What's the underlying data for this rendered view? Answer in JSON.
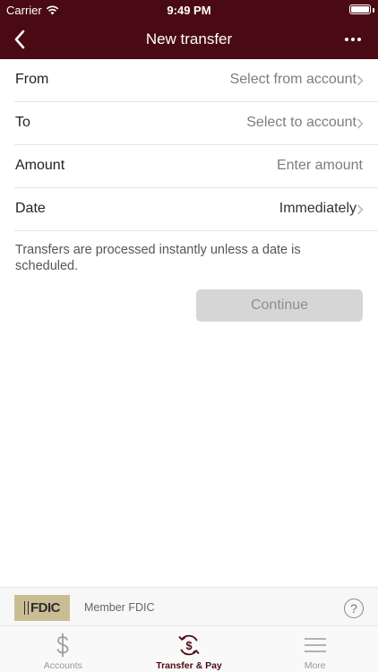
{
  "status_bar": {
    "carrier": "Carrier",
    "time": "9:49 PM"
  },
  "nav": {
    "title": "New transfer",
    "back_icon": "chevron-left-icon",
    "more_icon": "ellipsis-icon"
  },
  "form": {
    "rows": [
      {
        "label": "From",
        "value": "Select from account"
      },
      {
        "label": "To",
        "value": "Select to account"
      },
      {
        "label": "Amount",
        "placeholder": "Enter amount",
        "value": ""
      },
      {
        "label": "Date",
        "value": "Immediately"
      }
    ],
    "note": "Transfers are processed instantly unless a date is scheduled.",
    "continue_label": "Continue"
  },
  "footer": {
    "fdic_logo": "FDIC",
    "fdic_text": "Member FDIC",
    "help_icon": "question-circle-icon"
  },
  "tabs": [
    {
      "label": "Accounts",
      "icon": "dollar-icon",
      "active": false
    },
    {
      "label": "Transfer & Pay",
      "icon": "transfer-dollar-icon",
      "active": true
    },
    {
      "label": "More",
      "icon": "menu-icon",
      "active": false
    }
  ],
  "colors": {
    "brand": "#4a0a14",
    "button_disabled": "#d6d6d6"
  }
}
